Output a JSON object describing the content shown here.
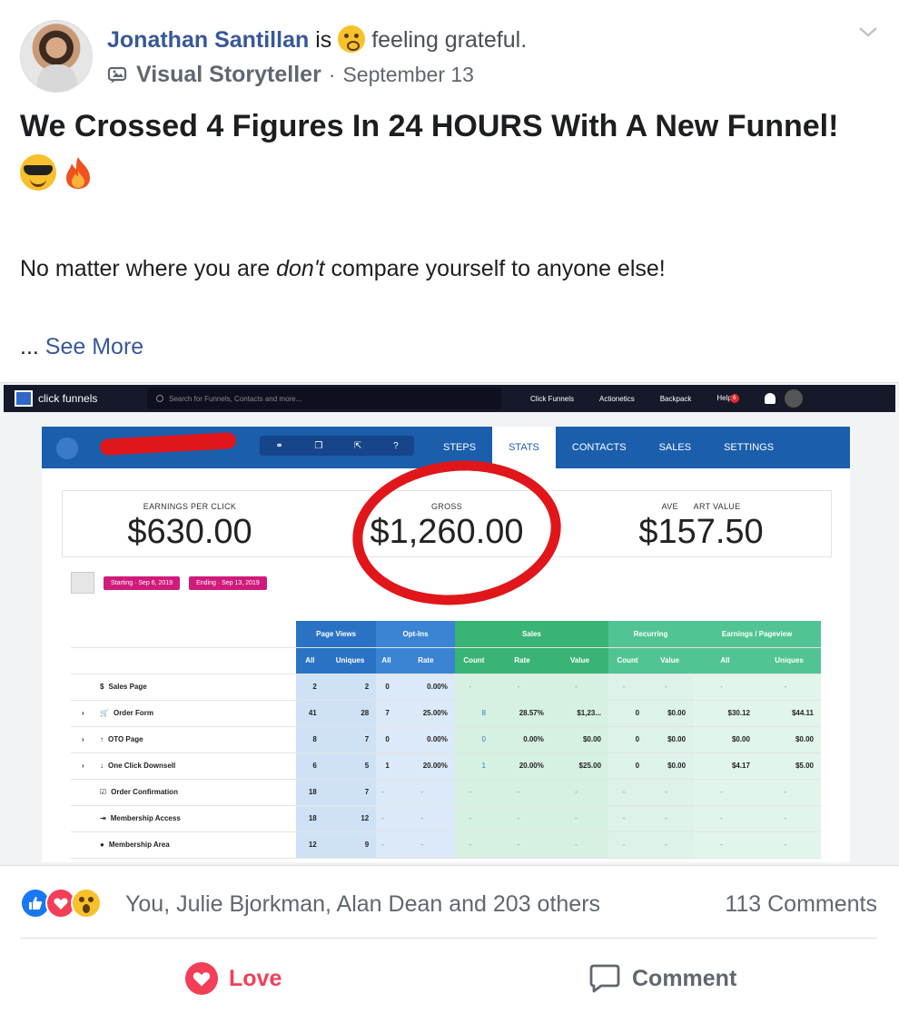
{
  "post": {
    "author": "Jonathan Santillan",
    "is_text": "is",
    "feeling": "feeling grateful.",
    "group_badge": "Visual Storyteller",
    "separator": "·",
    "date": "September 13",
    "title": "We Crossed 4 Figures In 24 HOURS With A New Funnel!",
    "body_before": "No matter where you are ",
    "body_em": "don't",
    "body_after": " compare yourself to anyone else!",
    "see_more_dots": "...",
    "see_more": "See More"
  },
  "screenshot": {
    "logo": "click funnels",
    "search_placeholder": "Search for Funnels, Contacts and more...",
    "nav": [
      "Click Funnels",
      "Actionetics",
      "Backpack",
      "Help"
    ],
    "help_badge": "6",
    "tabs": [
      "STEPS",
      "STATS",
      "CONTACTS",
      "SALES",
      "SETTINGS"
    ],
    "stats": {
      "epc_label": "EARNINGS PER CLICK",
      "epc_value": "$630.00",
      "gross_label": "GROSS",
      "gross_value": "$1,260.00",
      "acv_label": "AVE      ART VALUE",
      "acv_value": "$157.50"
    },
    "filter_start": "Starting · Sep 6, 2019",
    "filter_end": "Ending · Sep 13, 2019",
    "group_headers": [
      "Page Views",
      "Opt-Ins",
      "Sales",
      "Recurring",
      "Earnings / Pageview"
    ],
    "sub_headers": [
      "All",
      "Uniques",
      "All",
      "Rate",
      "Count",
      "Rate",
      "Value",
      "Count",
      "Value",
      "All",
      "Uniques"
    ],
    "rows": [
      {
        "icon": "$",
        "label": "Sales Page",
        "cells": [
          "2",
          "2",
          "0",
          "0.00%",
          "-",
          "-",
          "-",
          "-",
          "-",
          "-",
          "-"
        ]
      },
      {
        "icon": "cart",
        "label": "Order Form",
        "cells": [
          "41",
          "28",
          "7",
          "25.00%",
          "8",
          "28.57%",
          "$1,23...",
          "0",
          "$0.00",
          "$30.12",
          "$44.11"
        ]
      },
      {
        "icon": "up",
        "label": "OTO Page",
        "cells": [
          "8",
          "7",
          "0",
          "0.00%",
          "0",
          "0.00%",
          "$0.00",
          "0",
          "$0.00",
          "$0.00",
          "$0.00"
        ]
      },
      {
        "icon": "down",
        "label": "One Click Downsell",
        "cells": [
          "6",
          "5",
          "1",
          "20.00%",
          "1",
          "20.00%",
          "$25.00",
          "0",
          "$0.00",
          "$4.17",
          "$5.00"
        ]
      },
      {
        "icon": "check",
        "label": "Order Confirmation",
        "cells": [
          "18",
          "7",
          "-",
          "-",
          "-",
          "-",
          "-",
          "-",
          "-",
          "-",
          "-"
        ]
      },
      {
        "icon": "login",
        "label": "Membership Access",
        "cells": [
          "18",
          "12",
          "-",
          "-",
          "-",
          "-",
          "-",
          "-",
          "-",
          "-",
          "-"
        ]
      },
      {
        "icon": "group",
        "label": "Membership Area",
        "cells": [
          "12",
          "9",
          "-",
          "-",
          "-",
          "-",
          "-",
          "-",
          "-",
          "-",
          "-"
        ]
      }
    ]
  },
  "footer": {
    "reactions_text": "You, Julie Bjorkman, Alan Dean and 203 others",
    "comments": "113 Comments",
    "love_label": "Love",
    "comment_label": "Comment"
  },
  "colors": {
    "link_blue": "#385898",
    "love_red": "#f33e58",
    "cf_blue": "#1a5eac",
    "annotation_red": "#e0161a"
  }
}
